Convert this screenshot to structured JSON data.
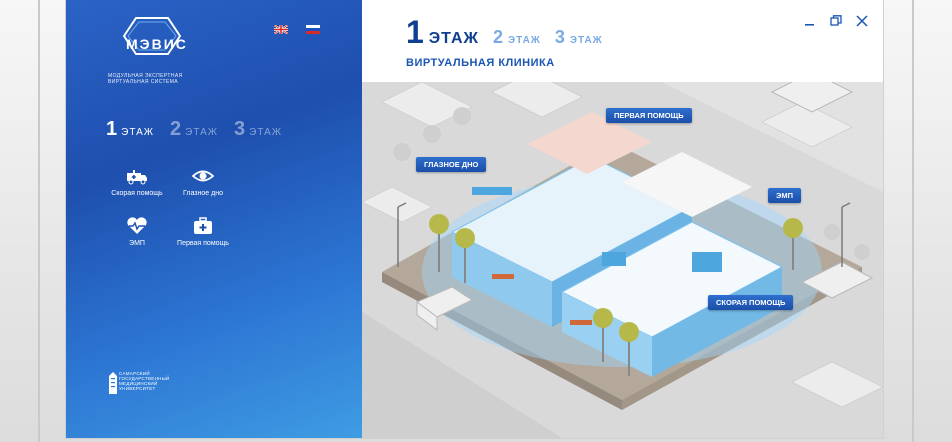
{
  "app": {
    "name": "МЭВИС",
    "subtitle_lines": [
      "МОДУЛЬНАЯ ЭКСПЕРТНАЯ",
      "ВИРТУАЛЬНАЯ СИСТЕМА"
    ]
  },
  "languages": [
    "EN",
    "RU"
  ],
  "sidebar": {
    "floors": [
      {
        "num": "1",
        "label": "ЭТАЖ"
      },
      {
        "num": "2",
        "label": "ЭТАЖ"
      },
      {
        "num": "3",
        "label": "ЭТАЖ"
      }
    ],
    "menu": [
      {
        "label": "Скорая помощь",
        "icon": "ambulance-icon"
      },
      {
        "label": "Глазное дно",
        "icon": "eye-icon"
      },
      {
        "label": "ЭМП",
        "icon": "heart-pulse-icon"
      },
      {
        "label": "Первая помощь",
        "icon": "first-aid-kit-icon"
      }
    ],
    "university_lines": [
      "САМАРСКИЙ",
      "ГОСУДАРСТВЕННЫЙ",
      "МЕДИЦИНСКИЙ",
      "УНИВЕРСИТЕТ"
    ]
  },
  "main": {
    "floors": [
      {
        "num": "1",
        "label": "ЭТАЖ"
      },
      {
        "num": "2",
        "label": "ЭТАЖ"
      },
      {
        "num": "3",
        "label": "ЭТАЖ"
      }
    ],
    "subtitle": "ВИРТУАЛЬНАЯ КЛИНИКА",
    "map_tags": {
      "first_aid": "ПЕРВАЯ ПОМОЩЬ",
      "eye_fundus": "ГЛАЗНОЕ ДНО",
      "emp": "ЭМП",
      "ambulance": "СКОРАЯ ПОМОЩЬ"
    }
  },
  "colors": {
    "accent": "#1a56b4",
    "sidebar_top": "#2a63c6",
    "sidebar_bottom": "#3f9ce3"
  }
}
